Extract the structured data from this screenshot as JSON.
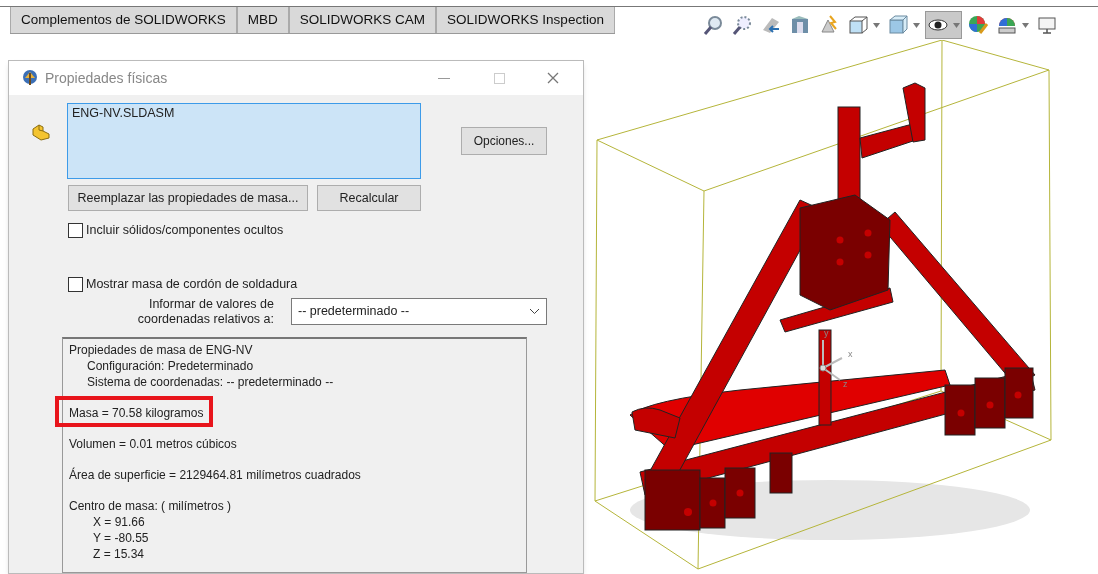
{
  "tabs": [
    {
      "label": "Complementos de SOLIDWORKS"
    },
    {
      "label": "MBD"
    },
    {
      "label": "SOLIDWORKS CAM"
    },
    {
      "label": "SOLIDWORKS Inspection"
    }
  ],
  "toolbar": [
    {
      "kind": "zoom-fit",
      "pressed": false,
      "dropdown": false
    },
    {
      "kind": "zoom-area",
      "pressed": false,
      "dropdown": false
    },
    {
      "kind": "previous-view",
      "pressed": false,
      "dropdown": false
    },
    {
      "kind": "section",
      "pressed": false,
      "dropdown": false
    },
    {
      "kind": "dynamic",
      "pressed": false,
      "dropdown": false
    },
    {
      "kind": "orientation",
      "pressed": false,
      "dropdown": true
    },
    {
      "kind": "display-style",
      "pressed": false,
      "dropdown": true
    },
    {
      "kind": "hide-show",
      "pressed": true,
      "dropdown": true
    },
    {
      "kind": "appearance",
      "pressed": false,
      "dropdown": false
    },
    {
      "kind": "scene",
      "pressed": false,
      "dropdown": true
    },
    {
      "kind": "display",
      "pressed": false,
      "dropdown": false
    }
  ],
  "dialog": {
    "title": "Propiedades físicas",
    "selection": [
      "ENG-NV.SLDASM"
    ],
    "options_button": "Opciones...",
    "buttons": [
      "Reemplazar las propiedades de masa...",
      "Recalcular"
    ],
    "checkboxes": [
      {
        "label": "Incluir sólidos/componentes ocultos",
        "checked": false
      },
      {
        "label": "Mostrar masa de cordón de soldadura",
        "checked": false
      }
    ],
    "coordinates_label": [
      "Informar de valores de",
      "coordenadas relativos a:"
    ],
    "coordinates_select": "-- predeterminado --",
    "results": [
      {
        "text": "Propiedades de masa de ENG-NV",
        "highlighted": false,
        "children": [
          {
            "text": "Configuración:  Predeterminado"
          },
          {
            "text": "Sistema de coordenadas:  -- predeterminado --"
          }
        ]
      },
      {
        "text": "Masa = 70.58 kilogramos",
        "highlighted": true
      },
      {
        "text": "Volumen = 0.01 metros cúbicos",
        "highlighted": false
      },
      {
        "text": "Área de superficie = 2129464.81  milímetros cuadrados",
        "highlighted": false
      },
      {
        "text": "Centro de masa: ( milímetros )",
        "highlighted": false,
        "children": [
          {
            "text": "X = 91.66"
          },
          {
            "text": "Y = -80.55"
          },
          {
            "text": "Z = 15.34"
          }
        ]
      }
    ]
  },
  "viewport": {
    "triad_labels": [
      "y",
      "x",
      "z"
    ]
  }
}
